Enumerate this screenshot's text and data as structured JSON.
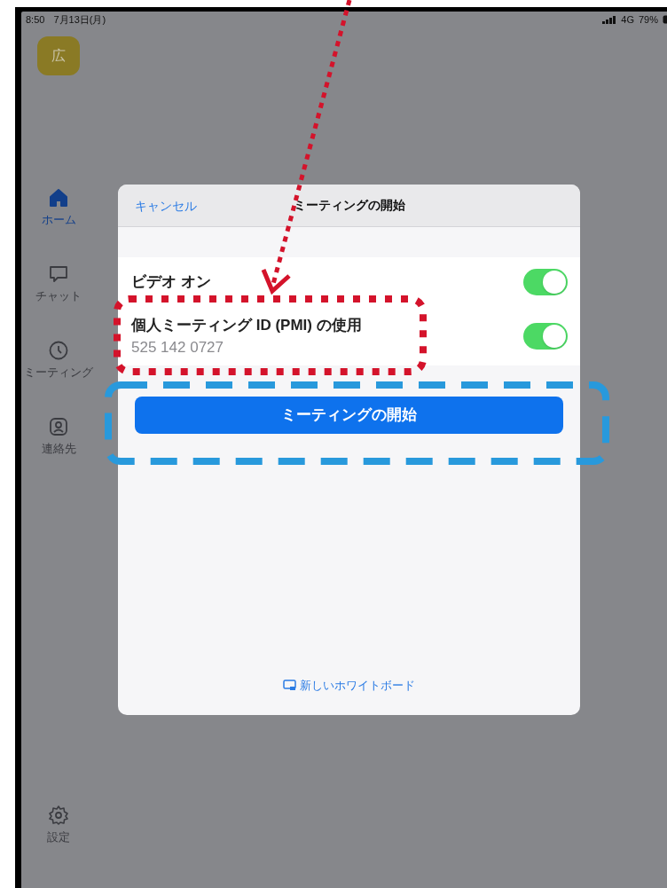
{
  "status_bar": {
    "time": "8:50",
    "date": "7月13日(月)",
    "network": "4G",
    "battery": "79%"
  },
  "avatar": {
    "initial": "広"
  },
  "sidebar": {
    "items": [
      {
        "label": "ホーム",
        "selected": true
      },
      {
        "label": "チャット",
        "selected": false
      },
      {
        "label": "ミーティング",
        "selected": false
      },
      {
        "label": "連絡先",
        "selected": false
      }
    ],
    "settings": {
      "label": "設定",
      "selected": false
    }
  },
  "dialog": {
    "cancel": "キャンセル",
    "title": "ミーティングの開始",
    "options": [
      {
        "label": "ビデオ オン",
        "on": true
      },
      {
        "label": "個人ミーティング ID (PMI) の使用",
        "detail": "525 142 0727",
        "on": true
      }
    ],
    "start_button": "ミーティングの開始",
    "whiteboard_link": "新しいホワイトボード"
  }
}
